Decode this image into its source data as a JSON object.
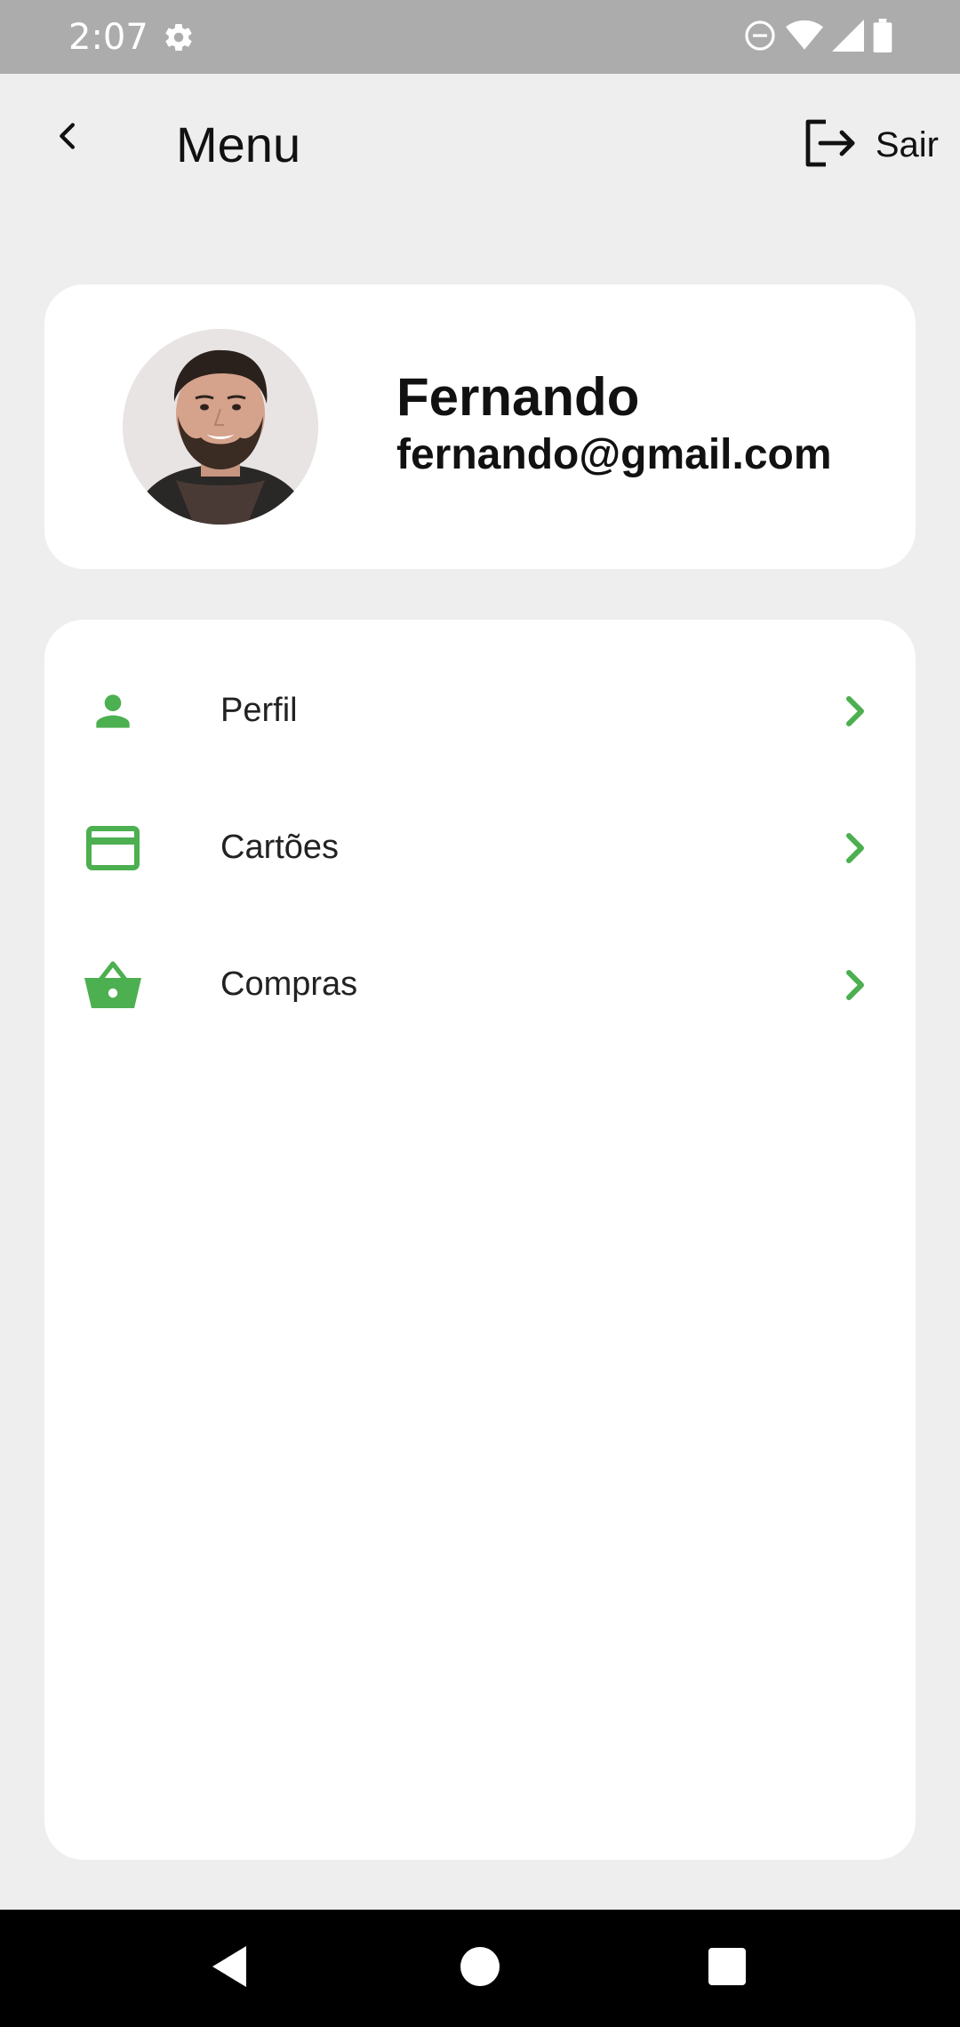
{
  "status_bar": {
    "time": "2:07",
    "icons": [
      "settings-icon",
      "do-not-disturb-icon",
      "wifi-icon",
      "signal-icon",
      "battery-icon"
    ]
  },
  "header": {
    "title": "Menu",
    "logout_label": "Sair",
    "icons": [
      "back-arrow-icon",
      "logout-icon"
    ]
  },
  "profile": {
    "name": "Fernando",
    "email": "fernando@gmail.com"
  },
  "menu": {
    "items": [
      {
        "label": "Perfil",
        "icon": "person-icon"
      },
      {
        "label": "Cartões",
        "icon": "credit-card-icon"
      },
      {
        "label": "Compras",
        "icon": "shopping-basket-icon"
      }
    ]
  },
  "colors": {
    "accent": "#4caf50",
    "background": "#eeeeee",
    "card": "#ffffff",
    "status_bar": "#acacac"
  }
}
